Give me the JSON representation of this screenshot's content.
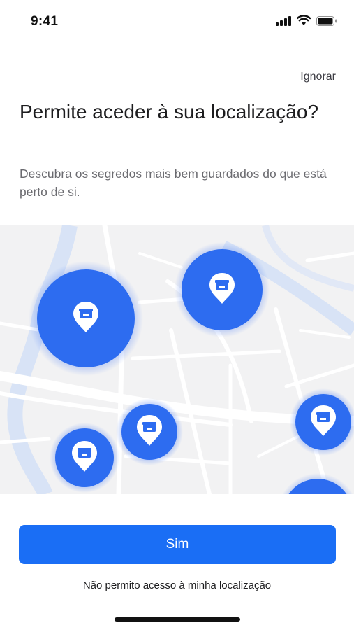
{
  "status_bar": {
    "time": "9:41"
  },
  "header": {
    "skip_label": "Ignorar"
  },
  "content": {
    "title": "Permite aceder à sua localização?",
    "subtitle": "Descubra os segredos mais bem guardados do que está perto de si."
  },
  "map": {
    "markers_count_label": "",
    "marker_icon": "store-pin-icon",
    "accent_color": "#2d6cf0"
  },
  "actions": {
    "primary_label": "Sim",
    "secondary_label": "Não permito acesso à minha localização"
  },
  "colors": {
    "primary": "#1a6ef5",
    "map_background": "#f2f2f3"
  }
}
